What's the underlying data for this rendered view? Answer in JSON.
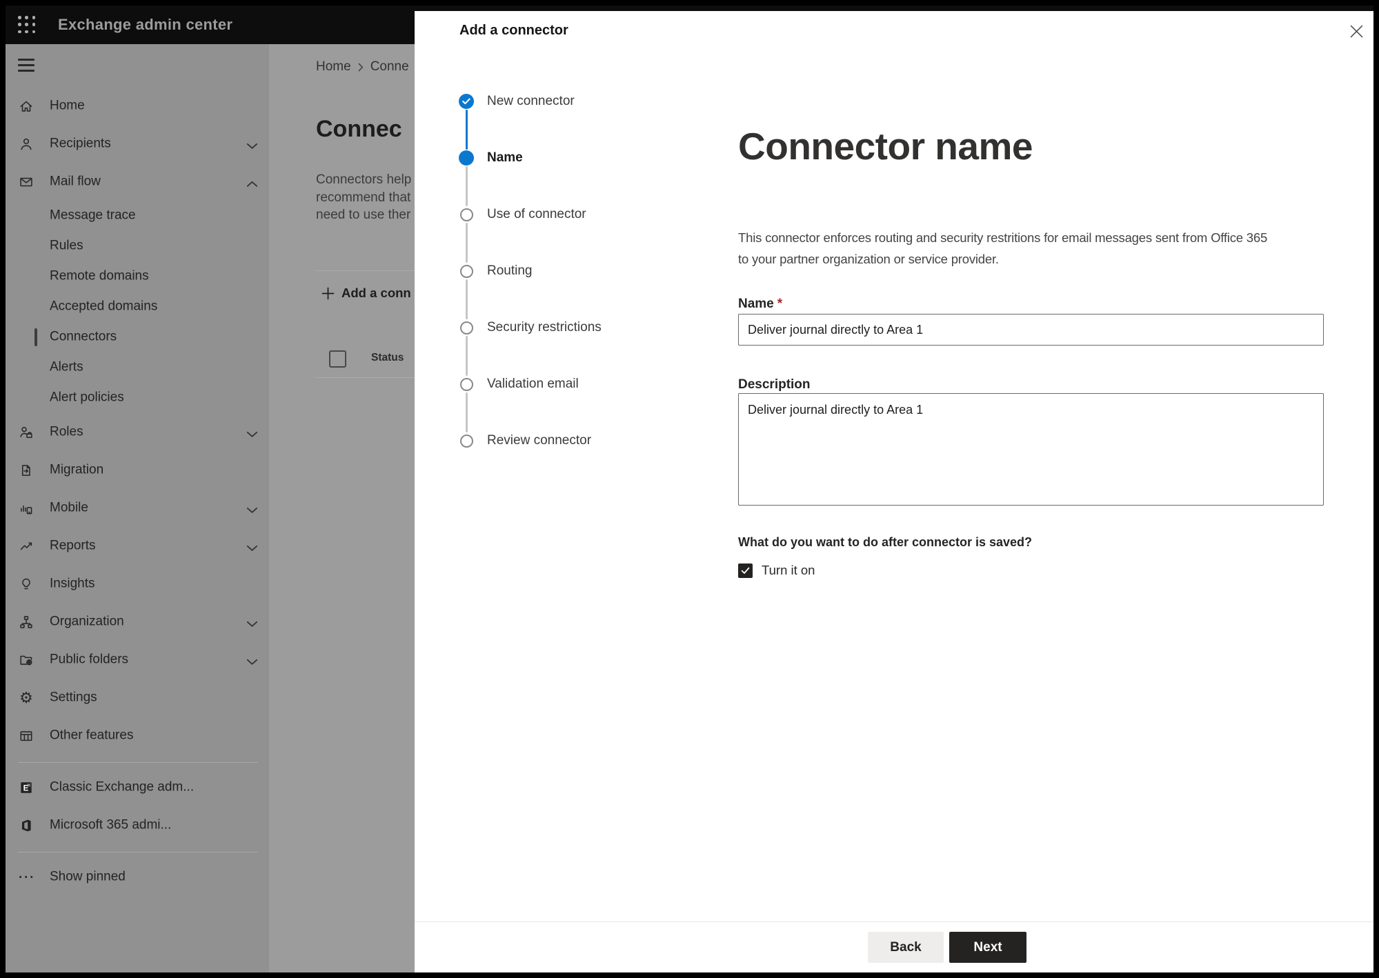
{
  "colors": {
    "accent_blue": "#0b78d0",
    "topbar_bg": "#0d0d0d",
    "sidebar_dim_bg": "#919191",
    "main_dim_bg": "#9c9c9c",
    "modal_bg": "#ffffff",
    "required_red": "#a4262c",
    "dark_button": "#242322"
  },
  "topbar": {
    "title": "Exchange admin center"
  },
  "sidebar": {
    "items": [
      {
        "type": "item",
        "label": "Home",
        "icon": "home-icon"
      },
      {
        "type": "item",
        "label": "Recipients",
        "icon": "person-icon",
        "chevron": "down"
      },
      {
        "type": "item",
        "label": "Mail flow",
        "icon": "mail-icon",
        "chevron": "up"
      },
      {
        "type": "sub",
        "label": "Message trace"
      },
      {
        "type": "sub",
        "label": "Rules"
      },
      {
        "type": "sub",
        "label": "Remote domains"
      },
      {
        "type": "sub",
        "label": "Accepted domains"
      },
      {
        "type": "sub",
        "label": "Connectors",
        "selected": true
      },
      {
        "type": "sub",
        "label": "Alerts"
      },
      {
        "type": "sub",
        "label": "Alert policies"
      },
      {
        "type": "item",
        "label": "Roles",
        "icon": "roles-icon",
        "chevron": "down"
      },
      {
        "type": "item",
        "label": "Migration",
        "icon": "migration-icon"
      },
      {
        "type": "item",
        "label": "Mobile",
        "icon": "mobile-icon",
        "chevron": "down"
      },
      {
        "type": "item",
        "label": "Reports",
        "icon": "reports-icon",
        "chevron": "down"
      },
      {
        "type": "item",
        "label": "Insights",
        "icon": "insights-icon"
      },
      {
        "type": "item",
        "label": "Organization",
        "icon": "organization-icon",
        "chevron": "down"
      },
      {
        "type": "item",
        "label": "Public folders",
        "icon": "public-folders-icon",
        "chevron": "down"
      },
      {
        "type": "item",
        "label": "Settings",
        "icon": "settings-gear-icon"
      },
      {
        "type": "item",
        "label": "Other features",
        "icon": "other-features-icon"
      },
      {
        "type": "divider"
      },
      {
        "type": "item",
        "label": "Classic Exchange adm...",
        "icon": "classic-exchange-icon"
      },
      {
        "type": "item",
        "label": "Microsoft 365 admi...",
        "icon": "microsoft-365-icon"
      },
      {
        "type": "divider"
      },
      {
        "type": "item",
        "label": "Show pinned",
        "icon": "more-dots-icon"
      }
    ]
  },
  "page": {
    "breadcrumb": {
      "home": "Home",
      "current": "Conne"
    },
    "heading": "Connec",
    "description_lines": [
      "Connectors help",
      "recommend that",
      "need to use ther"
    ],
    "add_button_label": "Add a conn",
    "table": {
      "status_header": "Status"
    }
  },
  "modal": {
    "title": "Add a connector",
    "steps": [
      {
        "label": "New connector",
        "state": "done"
      },
      {
        "label": "Name",
        "state": "current"
      },
      {
        "label": "Use of connector",
        "state": "upcoming"
      },
      {
        "label": "Routing",
        "state": "upcoming"
      },
      {
        "label": "Security restrictions",
        "state": "upcoming"
      },
      {
        "label": "Validation email",
        "state": "upcoming"
      },
      {
        "label": "Review connector",
        "state": "upcoming"
      }
    ],
    "content": {
      "heading": "Connector name",
      "description_lines": [
        "This connector enforces routing and security restritions for email messages sent from Office 365",
        "to your partner organization or service provider."
      ],
      "name_label": "Name",
      "required_marker": "*",
      "name_value": "Deliver journal directly to Area 1",
      "description_label": "Description",
      "description_value": "Deliver journal directly to Area 1",
      "after_save_question": "What do you want to do after connector is saved?",
      "turn_on_label": "Turn it on",
      "turn_on_checked": true
    },
    "footer": {
      "back_label": "Back",
      "next_label": "Next"
    }
  }
}
